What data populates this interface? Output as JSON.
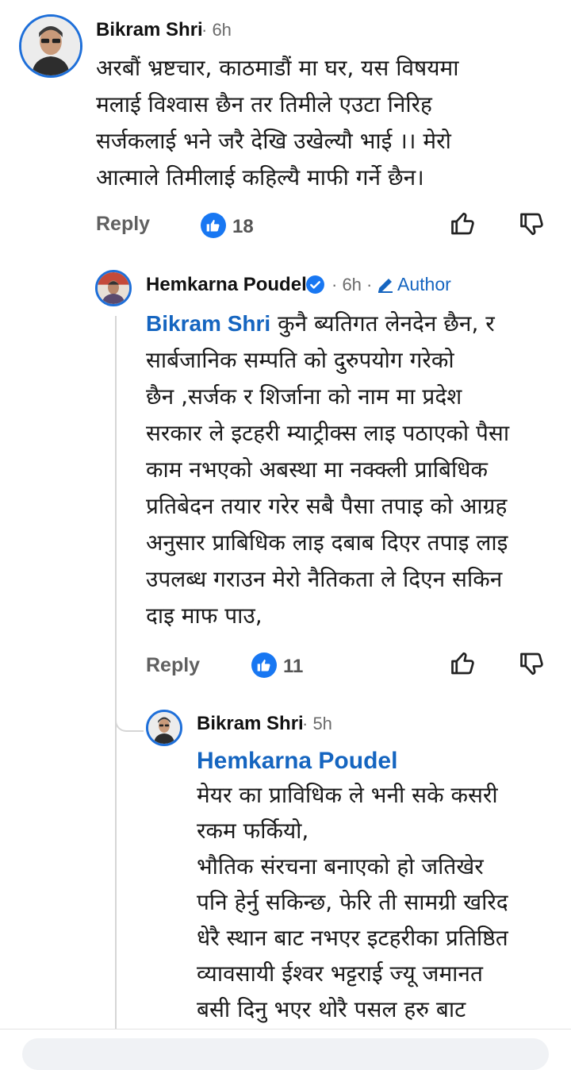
{
  "comments": [
    {
      "author": "Bikram Shri",
      "time": "· 6h",
      "lines": [
        "अरबौं भ्रष्टचार, काठमाडौं मा घर, यस विषयमा",
        "मलाई विश्वास छैन तर तिमीले एउटा निरिह",
        "सर्जकलाई भने जरै देखि उखेल्यौ भाई ।। मेरो",
        "आत्माले तिमीलाई कहिल्यै माफी गर्ने छैन।"
      ],
      "reply_label": "Reply",
      "likes": "18"
    },
    {
      "author": "Hemkarna Poudel",
      "time": "· 6h ·",
      "author_badge": "Author",
      "mention": "Bikram Shri",
      "first_line_rest": " कुनै ब्यतिगत लेनदेन छैन, र",
      "lines": [
        "सार्बजानिक सम्पति को दुरुपयोग गरेको",
        "छैन ,सर्जक र शिर्जाना को नाम मा प्रदेश",
        "सरकार ले इटहरी म्याट्रीक्स लाइ पठाएको पैसा",
        "काम नभएको अबस्था मा नक्क्ली प्राबिधिक",
        "प्रतिबेदन तयार गरेर सबै पैसा तपाइ को आग्रह",
        "अनुसार प्राबिधिक लाइ दबाब दिएर तपाइ लाइ",
        "उपलब्ध गराउन मेरो नैतिकता ले दिएन सकिन",
        "दाइ माफ पाउ,"
      ],
      "reply_label": "Reply",
      "likes": "11"
    },
    {
      "author": "Bikram Shri",
      "time": "· 5h",
      "mention": "Hemkarna Poudel",
      "lines": [
        "मेयर का प्राविधिक ले भनी सके कसरी",
        "रकम फर्कियो,",
        "भौतिक संरचना बनाएको हो जतिखेर",
        "पनि हेर्नु सकिन्छ, फेरि ती सामग्री खरिद",
        "धेरै स्थान बाट नभएर इटहरीका प्रतिष्ठित",
        "व्यावसायी ईश्वर भट्टराई ज्यू जमानत",
        "बसी दिनु भएर थोरै पसल हरु बाट"
      ]
    }
  ],
  "colors": {
    "accent": "#1565c0",
    "like_blue": "#1877f2",
    "thread": "#d6d6d6"
  },
  "icons": [
    "thumbs-up-icon",
    "thumbs-down-icon",
    "like-badge-icon",
    "verified-icon",
    "pencil-icon"
  ]
}
